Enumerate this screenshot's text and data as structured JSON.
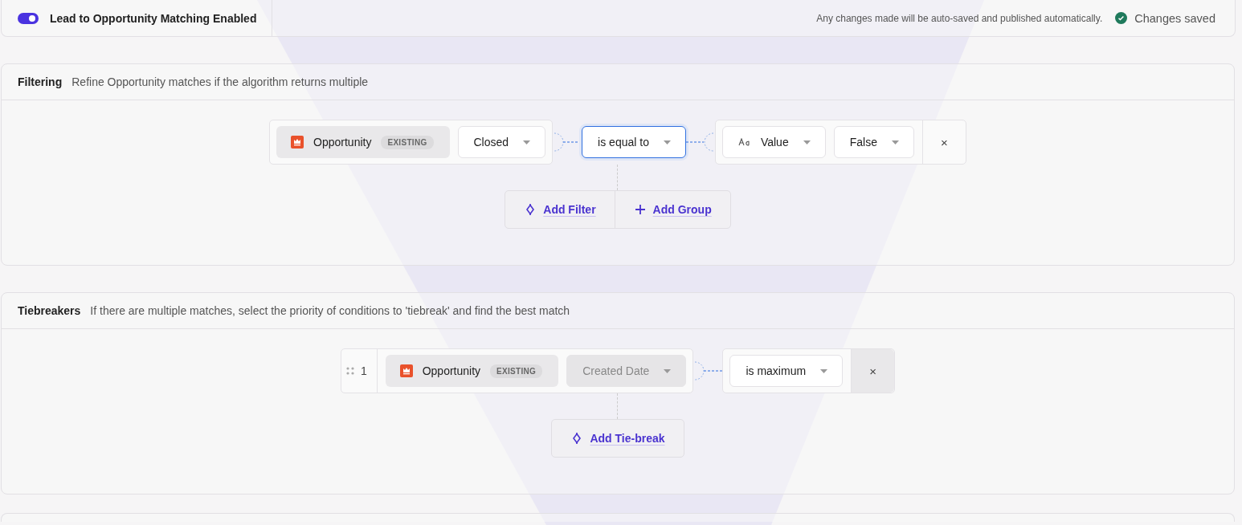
{
  "header": {
    "toggle": {
      "on": true
    },
    "title": "Lead to Opportunity Matching Enabled",
    "autosave_note": "Any changes made will be auto-saved and published automatically.",
    "save_status": "Changes saved"
  },
  "filtering": {
    "title": "Filtering",
    "description": "Refine Opportunity matches if the algorithm returns multiple",
    "condition": {
      "object": {
        "label": "Opportunity",
        "badge": "EXISTING"
      },
      "field": {
        "label": "Closed",
        "disabled": false
      },
      "operator": {
        "label": "is equal to",
        "focused": true
      },
      "value_type": "Value",
      "value": "False",
      "remove": "×"
    },
    "actions": [
      {
        "kind": "filter",
        "label": "Add Filter"
      },
      {
        "kind": "group",
        "label": "Add Group"
      }
    ]
  },
  "tiebreakers": {
    "title": "Tiebreakers",
    "description": "If there are multiple matches, select the priority of conditions to 'tiebreak' and find the best match",
    "rules": [
      {
        "index": "1",
        "object": {
          "label": "Opportunity",
          "badge": "EXISTING"
        },
        "field": {
          "label": "Created Date",
          "disabled": true
        },
        "operator": {
          "label": "is maximum",
          "focused": false
        },
        "remove": "×"
      }
    ],
    "actions": [
      {
        "kind": "tiebreak",
        "label": "Add Tie-break"
      }
    ]
  }
}
